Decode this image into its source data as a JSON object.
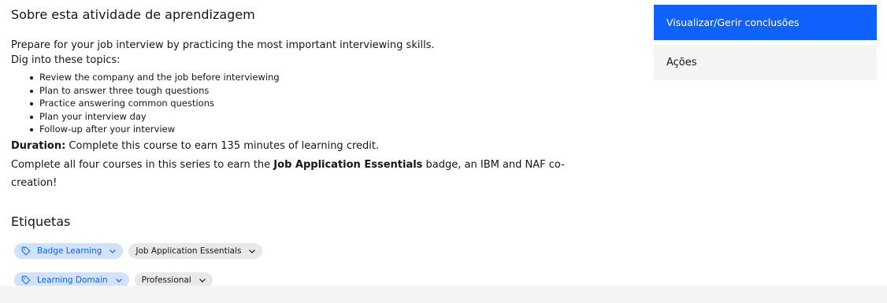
{
  "about": {
    "title": "Sobre esta atividade de aprendizagem",
    "intro": "Prepare for your job interview by practicing the most important interviewing skills.",
    "dig_into": "Dig into these topics:",
    "topics": [
      "Review the company and the job before interviewing",
      "Plan to answer three tough questions",
      "Practice answering common questions",
      "Plan your interview day",
      "Follow-up after your interview"
    ],
    "duration_label": "Duration:",
    "duration_text": " Complete this course to earn 135 minutes of learning credit.",
    "series_before": "Complete all four courses in this series to earn the ",
    "series_badge": "Job Application Essentials",
    "series_after": " badge, an IBM and NAF co-creation!"
  },
  "tags": {
    "title": "Etiquetas",
    "rows": [
      {
        "key": "Badge Learning",
        "value": "Job Application Essentials"
      },
      {
        "key": "Learning Domain",
        "value": "Professional"
      }
    ]
  },
  "sidebar": {
    "primary_button": "Visualizar/Gerir conclusões",
    "actions_label": "Ações"
  },
  "icons": {
    "tag": "tag-icon",
    "chevron": "chevron-down-icon"
  },
  "colors": {
    "primary": "#0f62fe",
    "tag_key_bg": "#d0e2ff",
    "tag_value_bg": "#e8e8e8",
    "panel_bg": "#f4f4f4"
  }
}
